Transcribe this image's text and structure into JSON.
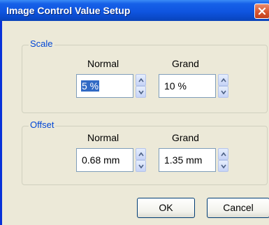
{
  "window": {
    "title": "Image Control Value Setup"
  },
  "scale": {
    "group_label": "Scale",
    "normal_label": "Normal",
    "grand_label": "Grand",
    "normal_value": "5 %",
    "grand_value": "10 %"
  },
  "offset": {
    "group_label": "Offset",
    "normal_label": "Normal",
    "grand_label": "Grand",
    "normal_value": "0.68 mm",
    "grand_value": "1.35 mm"
  },
  "buttons": {
    "ok_label": "OK",
    "cancel_label": "Cancel"
  },
  "icons": {
    "close": "close-icon",
    "spin_up": "chevron-up-icon",
    "spin_down": "chevron-down-icon"
  },
  "colors": {
    "titlebar": "#0f55e0",
    "dialog_bg": "#ece9d8",
    "group_label": "#0046d5",
    "selection": "#316ac5",
    "close_button": "#d8562f"
  }
}
